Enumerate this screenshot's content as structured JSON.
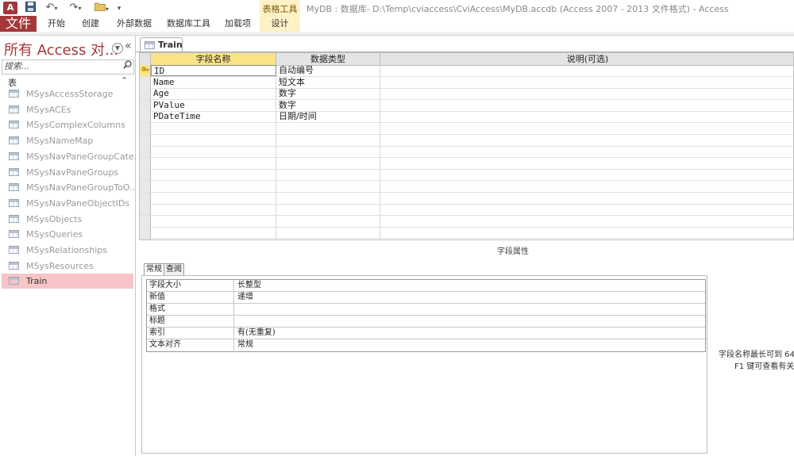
{
  "titlebar": {
    "app_icon_letter": "A",
    "window_title": "MyDB : 数据库- D:\\Temp\\cviaccess\\CviAccess\\MyDB.accdb (Access 2007 - 2013 文件格式) - Access",
    "contextual_group": "表格工具"
  },
  "ribbon_tabs": {
    "file": "文件",
    "home": "开始",
    "create": "创建",
    "external_data": "外部数据",
    "database_tools": "数据库工具",
    "addins": "加载项",
    "design": "设计"
  },
  "nav": {
    "title": "所有 Access 对...",
    "search_placeholder": "搜索...",
    "group_label": "表",
    "items": [
      "MSysAccessStorage",
      "MSysACEs",
      "MSysComplexColumns",
      "MSysNameMap",
      "MSysNavPaneGroupCate...",
      "MSysNavPaneGroups",
      "MSysNavPaneGroupToO...",
      "MSysNavPaneObjectIDs",
      "MSysObjects",
      "MSysQueries",
      "MSysRelationships",
      "MSysResources",
      "Train"
    ],
    "selected_item": "Train"
  },
  "document": {
    "tab_label": "Train"
  },
  "design_grid": {
    "headers": {
      "field_name": "字段名称",
      "data_type": "数据类型",
      "description": "说明(可选)"
    },
    "rows": [
      {
        "name": "ID",
        "type": "自动编号",
        "desc": ""
      },
      {
        "name": "Name",
        "type": "短文本",
        "desc": ""
      },
      {
        "name": "Age",
        "type": "数字",
        "desc": ""
      },
      {
        "name": "PValue",
        "type": "数字",
        "desc": ""
      },
      {
        "name": "PDateTime",
        "type": "日期/时间",
        "desc": ""
      }
    ]
  },
  "field_properties": {
    "section_label": "字段属性",
    "tabs": {
      "general": "常规",
      "lookup": "查阅"
    },
    "rows": [
      {
        "name": "字段大小",
        "value": "长整型"
      },
      {
        "name": "新值",
        "value": "递增"
      },
      {
        "name": "格式",
        "value": ""
      },
      {
        "name": "标题",
        "value": ""
      },
      {
        "name": "索引",
        "value": "有(无重复)"
      },
      {
        "name": "文本对齐",
        "value": "常规"
      }
    ],
    "help_line1": "字段名称最长可到 64",
    "help_line2": "F1 键可查看有关"
  },
  "colors": {
    "access_red": "#a4373a",
    "selected_nav": "#f7c4c7",
    "header_highlight": "#fbe388",
    "contextual_tab": "#fdf1c6"
  }
}
